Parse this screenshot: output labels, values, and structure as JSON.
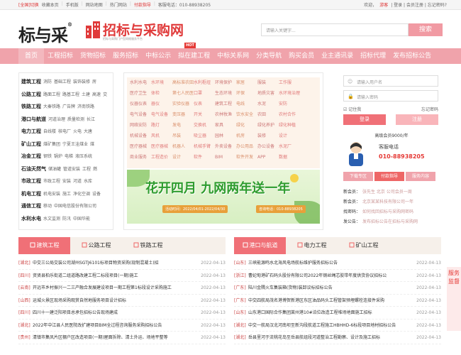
{
  "topbar": {
    "region": "[全国]切换",
    "links": [
      "收藏本页",
      "手机版",
      "网站地图",
      "热门网站"
    ],
    "pay": "付款指导",
    "hotline": "客服电话：010-88938205",
    "welcome": "欢迎，",
    "guest": "游客",
    "login_reg": "| 登录 | 会员注册 | 忘记密码?"
  },
  "header": {
    "logo_text": "标与采",
    "logo_reg": "®",
    "brand": "招标与采购网",
    "brand_sub": "招标与采购门户型网络服务平台",
    "search_placeholder": "请输入关键字...",
    "search_button": "搜索"
  },
  "nav": {
    "items": [
      "首页",
      "工程招标",
      "货物招标",
      "服务招标",
      "中标公示",
      "拟在建工程",
      "中标关系网",
      "分类导航",
      "购买会员",
      "业主通讯录",
      "招标代理",
      "发布招标公告"
    ],
    "hot_badge": "HOT"
  },
  "categories": [
    {
      "name": "建筑工程",
      "subs": [
        "消防",
        "基础工程",
        "装饰装修",
        "房"
      ]
    },
    {
      "name": "公路工程",
      "subs": [
        "路面工程",
        "路基工程",
        "土建",
        "高速",
        "交"
      ]
    },
    {
      "name": "铁路工程",
      "subs": [
        "大秦铁路",
        "广告牌",
        "济南铁路"
      ]
    },
    {
      "name": "港口与航道",
      "subs": [
        "河道治理",
        "质量检测",
        "长江"
      ]
    },
    {
      "name": "电力工程",
      "subs": [
        "自线楼",
        "核电厂",
        "火电",
        "大唐"
      ]
    },
    {
      "name": "矿山工程",
      "subs": [
        "煤矿集团",
        "宁夏王洼煤业",
        "煤"
      ]
    },
    {
      "name": "冶金工程",
      "subs": [
        "钢铁",
        "锅炉",
        "电梯",
        "液压系统"
      ]
    },
    {
      "name": "石油天然气",
      "subs": [
        "储油罐",
        "管道安装",
        "工程",
        "燃"
      ]
    },
    {
      "name": "市政工程",
      "subs": [
        "市政工程",
        "安装",
        "河道",
        "水库"
      ]
    },
    {
      "name": "机电工程",
      "subs": [
        "机电安装",
        "施工",
        "净化空调",
        "设备"
      ]
    },
    {
      "name": "通信工程",
      "subs": [
        "移动",
        "中国电信股份有限公司"
      ]
    },
    {
      "name": "水利水电",
      "subs": [
        "水文监测",
        "防汛",
        "中国华能"
      ]
    }
  ],
  "tag_rows": [
    [
      "水利水电",
      "水环境",
      "高标准农田",
      "水利枢纽",
      "环境保护",
      "家居",
      "服装",
      "工作服"
    ],
    [
      "医疗卫生",
      "体检",
      "第七人民医",
      "口罩",
      "生态环境",
      "环保",
      "地质灾害",
      "水环境治理"
    ],
    [
      "仪器仪表",
      "器仪",
      "实验仪器",
      "仪表",
      "建筑工程",
      "电线",
      "水泥",
      "安防"
    ],
    [
      "电气设备",
      "电气设备",
      "变压器",
      "开关",
      "农林牧渔",
      "饮水安全",
      "农田",
      "农村合作"
    ],
    [
      "网络安防",
      "路灯",
      "发电",
      "交换机",
      "家具",
      "绿化",
      "绿化养护",
      "绿化种植"
    ],
    [
      "机械设备",
      "风机",
      "吊装",
      "吸尘器",
      "园林",
      "机房",
      "装修",
      "设计"
    ],
    [
      "医疗器械",
      "医疗器械",
      "机器人",
      "机械手臂",
      "外卖设备",
      "办公用品",
      "办公设备",
      "水泥厂"
    ],
    [
      "商业服务",
      "工程造价",
      "设计",
      "软件",
      "BIM",
      "软件开发",
      "APP",
      "数据"
    ]
  ],
  "banner": {
    "title": "花开四月 九网两年送一年",
    "date": "活动时间：2022/04/01-2022/04/30",
    "tel": "咨询电话：010-88938205"
  },
  "login": {
    "username_placeholder": "请输入用户名",
    "password_placeholder": "请输入密码",
    "remember": "记住我",
    "forget": "忘记密码",
    "login_button": "登录",
    "register_button": "注册",
    "vip": "高级会员9000/年",
    "service_title": "客服电话",
    "service_phone": "010-88938205",
    "tabs": [
      "下载专区",
      "付款指导",
      "服务内容"
    ]
  },
  "notices": [
    {
      "label": "新会员：",
      "text": "张先生 北京 公司会员一周"
    },
    {
      "label": "新会员：",
      "text": "北京某某科技有限公司一年"
    },
    {
      "label": "找密码：",
      "text": "如何找回招标与采购网密码"
    },
    {
      "label": "发公告：",
      "text": "发布招标公告在招标与采购网"
    }
  ],
  "board_left": {
    "tabs": [
      "建筑工程",
      "公路工程",
      "铁路工程"
    ],
    "rows": [
      {
        "region": "[湖北]",
        "title": "中交三公局交装公司湖州SGTJ6101标项目物资采购(现制混凝土)招",
        "date": "2022-04-13"
      },
      {
        "region": "[四川]",
        "title": "资贤县柏乐街道二组道路改建工程二标段项目(一期)施工",
        "date": "2022-04-13"
      },
      {
        "region": "[云南]",
        "title": "开远市乡村振兴一二三产融合发展建设项目一期工程第1标段设计采购施工",
        "date": "2022-04-13"
      },
      {
        "region": "[山西]",
        "title": "运城火景区现场采购观赏自然地服务项目设计招标",
        "date": "2022-04-13"
      },
      {
        "region": "[四川]",
        "title": "四川十一建泛阳项目总承包招标公告现场建成",
        "date": "2022-04-13"
      },
      {
        "region": "[湖北]",
        "title": "2022年中江县人民医院改扩建项目BIM全过程咨询服务采购招标公告",
        "date": "2022-04-13"
      },
      {
        "region": "[贵州]",
        "title": "清镇市集凤片区棚户区改造项目(一期)屋面拆除、清土外运、场地平整等",
        "date": "2022-04-13"
      }
    ]
  },
  "board_right": {
    "tabs": [
      "港口与航道",
      "电力工程",
      "矿山工程"
    ],
    "rows": [
      {
        "region": "[山东]",
        "title": "三峡能源鸣水北海风电场航标维护服务招标公告",
        "date": "2022-04-13"
      },
      {
        "region": "[浙江]",
        "title": "曹妃甸港矿石码头股份有限公司2022年钢丝绳芯胶带年度供货协议招标公",
        "date": "2022-04-13"
      },
      {
        "region": "[广东]",
        "title": "陆川金隅火车集装箱(货物)装卸议标招标公告",
        "date": "2022-04-13"
      },
      {
        "region": "[广东]",
        "title": "中交四航局茂名港博贺新港区东区油品码头工程管架预埋螺栓连接件采购",
        "date": "2022-04-13"
      },
      {
        "region": "[山东]",
        "title": "山东港口国际合作集团莱州港10#泊位改造工程堆场地面施工招标",
        "date": "2022-04-13"
      },
      {
        "region": "[湖北]",
        "title": "中交一航局汉北河南坝至新沟段航道工程施工HBHHD-6标段项目地材招标公告",
        "date": "2022-04-13"
      },
      {
        "region": "[湖北]",
        "title": "岳县里河于流桃花岛至岳县航组段河道整治工程勘察、设计及施工招标",
        "date": "2022-04-13"
      }
    ]
  },
  "side_float": "服务监督"
}
